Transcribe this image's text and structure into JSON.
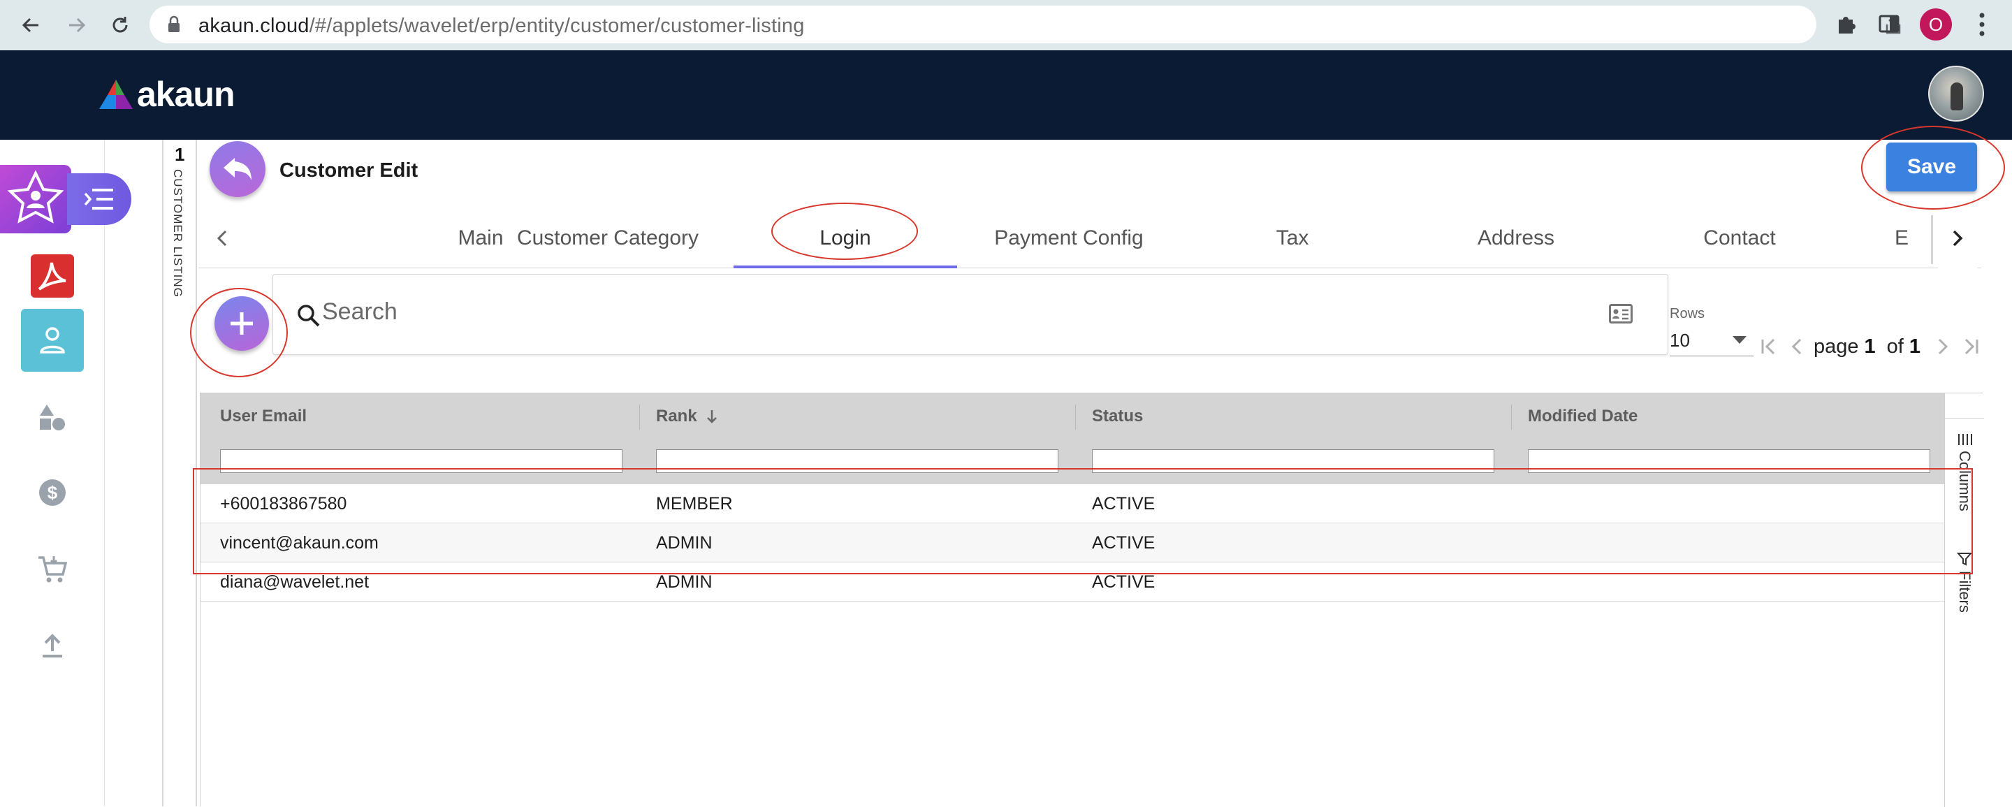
{
  "browser": {
    "url_host": "akaun.cloud",
    "url_path": "/#/applets/wavelet/erp/entity/customer/customer-listing",
    "profile_initial": "O",
    "back_icon": "arrow-left-icon",
    "forward_icon": "arrow-right-icon",
    "reload_icon": "reload-icon"
  },
  "app": {
    "logo_text": "akaun",
    "brand_colors": {
      "header_bg": "#0b1b33",
      "accent": "#3b82e0",
      "tab_ink": "#6f6ae6"
    }
  },
  "sidebar": {
    "items": [
      {
        "icon": "applet-star-icon"
      },
      {
        "icon": "menu-toggle-icon"
      },
      {
        "icon": "pdf-icon"
      },
      {
        "icon": "person-icon",
        "active": true
      },
      {
        "icon": "shapes-icon"
      },
      {
        "icon": "dollar-icon"
      },
      {
        "icon": "cart-icon"
      },
      {
        "icon": "upload-icon"
      }
    ]
  },
  "strip": {
    "number": "1",
    "label": "CUSTOMER LISTING"
  },
  "page": {
    "title": "Customer Edit",
    "save_label": "Save"
  },
  "tabs": {
    "items": [
      {
        "label": "Main"
      },
      {
        "label": "Customer Category"
      },
      {
        "label": "Login",
        "active": true
      },
      {
        "label": "Payment Config"
      },
      {
        "label": "Tax"
      },
      {
        "label": "Address"
      },
      {
        "label": "Contact"
      },
      {
        "label": "E"
      }
    ]
  },
  "search": {
    "placeholder": "Search"
  },
  "pagination": {
    "rows_label": "Rows",
    "rows_value": "10",
    "page_word": "page",
    "current_page": "1",
    "of_word": "of",
    "total_pages": "1"
  },
  "grid": {
    "columns": [
      {
        "label": "User Email"
      },
      {
        "label": "Rank",
        "sort": "descending"
      },
      {
        "label": "Status"
      },
      {
        "label": "Modified Date"
      }
    ],
    "rows": [
      {
        "user_email": "+600183867580",
        "rank": "MEMBER",
        "status": "ACTIVE",
        "modified_date": ""
      },
      {
        "user_email": "vincent@akaun.com",
        "rank": "ADMIN",
        "status": "ACTIVE",
        "modified_date": ""
      },
      {
        "user_email": "diana@wavelet.net",
        "rank": "ADMIN",
        "status": "ACTIVE",
        "modified_date": ""
      }
    ],
    "side_panel": {
      "columns_label": "Columns",
      "filters_label": "Filters"
    }
  }
}
